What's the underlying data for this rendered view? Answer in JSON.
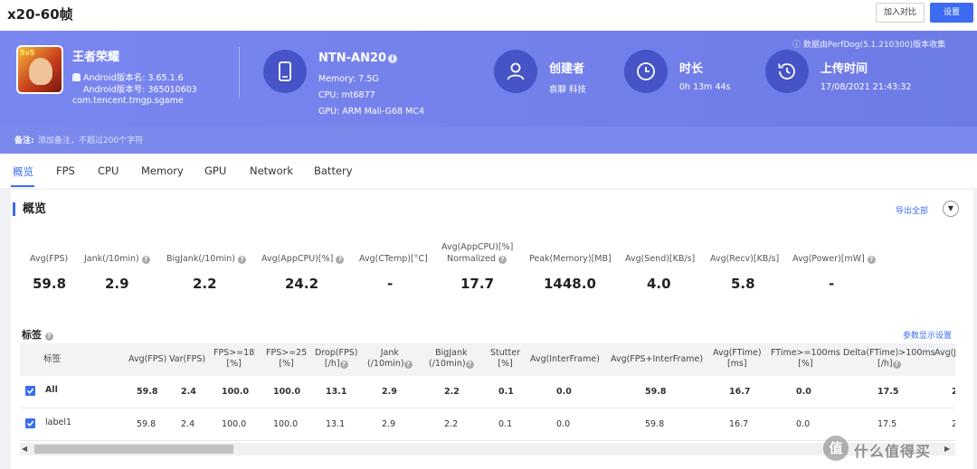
{
  "header": {
    "title": "x20-60帧",
    "compare_button": "加入对比",
    "settings_button": "设置"
  },
  "banner": {
    "collect_info": "ⓘ 数据由PerfDog(5.1.210300)版本收集",
    "game": {
      "icon_tag": "5v5",
      "name": "王者荣耀",
      "android_version": "Android版本名: 3.65.1.6",
      "android_code": "Android版本号: 365010603",
      "package": "com.tencent.tmgp.sgame"
    },
    "device": {
      "name": "NTN-AN20",
      "memory": "Memory: 7.5G",
      "cpu": "CPU: mt6877",
      "gpu": "GPU: ARM Mali-G68 MC4"
    },
    "creator": {
      "label": "创建者",
      "value": "哀聊 科技"
    },
    "duration": {
      "label": "时长",
      "value": "0h 13m 44s"
    },
    "upload_time": {
      "label": "上传时间",
      "value": "17/08/2021 21:43:32"
    },
    "note": {
      "label": "备注:",
      "placeholder": "添加备注，不超过200个字符"
    }
  },
  "tabs": [
    "概览",
    "FPS",
    "CPU",
    "Memory",
    "GPU",
    "Network",
    "Battery"
  ],
  "overview": {
    "title": "概览",
    "export_all": "导出全部",
    "collapse": "▼",
    "metrics": [
      {
        "label": "Avg(FPS)",
        "value": "59.8"
      },
      {
        "label": "Jank(/10min)",
        "value": "2.9"
      },
      {
        "label": "BigJank(/10min)",
        "value": "2.2"
      },
      {
        "label": "Avg(AppCPU)[%]",
        "value": "24.2"
      },
      {
        "label": "Avg(CTemp)[°C]",
        "value": "-"
      },
      {
        "label": "Avg(AppCPU)[%]",
        "label2": "Normalized",
        "value": "17.7"
      },
      {
        "label": "Peak(Memory)[MB]",
        "value": "1448.0"
      },
      {
        "label": "Avg(Send)[KB/s]",
        "value": "4.0"
      },
      {
        "label": "Avg(Recv)[KB/s]",
        "value": "5.8"
      },
      {
        "label": "Avg(Power)[mW]",
        "value": "-"
      }
    ]
  },
  "tags_section": {
    "title": "标签",
    "param_settings": "参数显示设置",
    "columns": [
      "标签",
      "Avg(FPS)",
      "Var(FPS)",
      "FPS>=18\n[%]",
      "FPS>=25\n[%]",
      "Drop(FPS)\n[/h]",
      "Jank\n(/10min)",
      "BigJank\n(/10min)",
      "Stutter\n[%]",
      "Avg(InterFrame)",
      "Avg(FPS+InterFrame)",
      "Avg(FTime)\n[ms]",
      "FTime>=100ms\n[%]",
      "Delta(FTime)>100ms\n[/h]",
      "Avg(J"
    ],
    "rows": [
      [
        "All",
        "59.8",
        "2.4",
        "100.0",
        "100.0",
        "13.1",
        "2.9",
        "2.2",
        "0.1",
        "0.0",
        "59.8",
        "16.7",
        "0.0",
        "17.5",
        "2"
      ],
      [
        "label1",
        "59.8",
        "2.4",
        "100.0",
        "100.0",
        "13.1",
        "2.9",
        "2.2",
        "0.1",
        "0.0",
        "59.8",
        "16.7",
        "0.0",
        "17.5",
        "2"
      ]
    ]
  },
  "watermark": {
    "logo": "值",
    "text": "什么值得买"
  },
  "colors": {
    "accent": "#3d6cf0",
    "banner": "#6e7be6",
    "icon_circle": "#4654c8"
  }
}
